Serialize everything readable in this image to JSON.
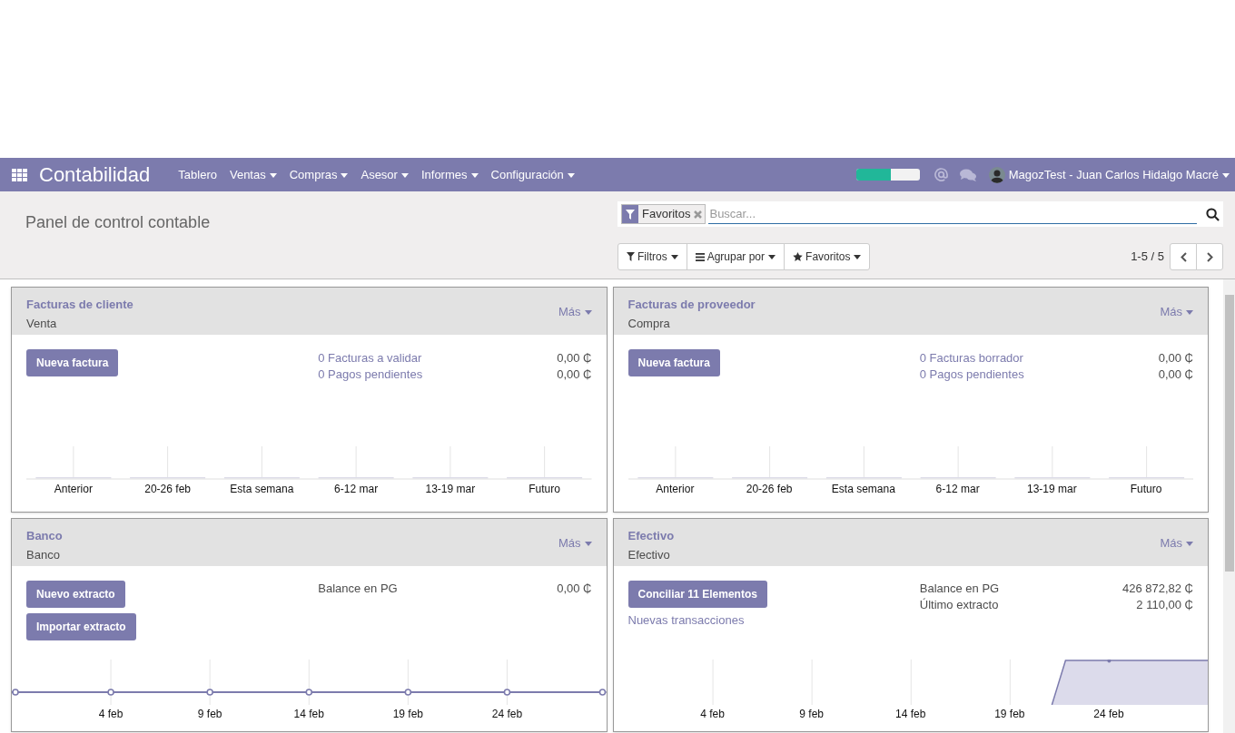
{
  "app": {
    "title": "Contabilidad"
  },
  "menu": [
    {
      "label": "Tablero",
      "dropdown": false
    },
    {
      "label": "Ventas",
      "dropdown": true
    },
    {
      "label": "Compras",
      "dropdown": true
    },
    {
      "label": "Asesor",
      "dropdown": true
    },
    {
      "label": "Informes",
      "dropdown": true
    },
    {
      "label": "Configuración",
      "dropdown": true
    }
  ],
  "systray": {
    "progress": {
      "level": 0.54
    },
    "user": "MagozTest - Juan Carlos Hidalgo Macré"
  },
  "control_panel": {
    "breadcrumb": "Panel de control contable",
    "search": {
      "facets": [
        "Favoritos"
      ],
      "placeholder": "Buscar..."
    },
    "buttons": [
      "Filtros",
      "Agrupar por",
      "Favoritos"
    ],
    "pager": "1-5 / 5"
  },
  "cards": [
    {
      "title": "Facturas de cliente",
      "subtitle": "Venta",
      "more": "Más",
      "buttons": [
        "Nueva factura"
      ],
      "stats": [
        {
          "label": "0 Facturas a validar",
          "value": "0,00 ₵",
          "kind": "link"
        },
        {
          "label": "0 Pagos pendientes",
          "value": "0,00 ₵",
          "kind": "link"
        }
      ],
      "chart": {
        "kind": "bar",
        "labels": [
          "Anterior",
          "20-26 feb",
          "Esta semana",
          "6-12 mar",
          "13-19 mar",
          "Futuro"
        ]
      }
    },
    {
      "title": "Facturas de proveedor",
      "subtitle": "Compra",
      "more": "Más",
      "buttons": [
        "Nueva factura"
      ],
      "stats": [
        {
          "label": "0 Facturas borrador",
          "value": "0,00 ₵",
          "kind": "link"
        },
        {
          "label": "0 Pagos pendientes",
          "value": "0,00 ₵",
          "kind": "link"
        }
      ],
      "chart": {
        "kind": "bar",
        "labels": [
          "Anterior",
          "20-26 feb",
          "Esta semana",
          "6-12 mar",
          "13-19 mar",
          "Futuro"
        ]
      }
    },
    {
      "title": "Banco",
      "subtitle": "Banco",
      "more": "Más",
      "buttons": [
        "Nuevo extracto",
        "Importar extracto"
      ],
      "stats": [
        {
          "label": "Balance en PG",
          "value": "0,00 ₵",
          "kind": "plain"
        }
      ],
      "chart": {
        "kind": "line",
        "labels": [
          "4 feb",
          "9 feb",
          "14 feb",
          "19 feb",
          "24 feb"
        ]
      }
    },
    {
      "title": "Efectivo",
      "subtitle": "Efectivo",
      "more": "Más",
      "buttons": [
        "Conciliar 11 Elementos"
      ],
      "links": [
        "Nuevas transacciones"
      ],
      "stats": [
        {
          "label": "Balance en PG",
          "value": "426 872,82 ₵",
          "kind": "plain"
        },
        {
          "label": "Último extracto",
          "value": "2 110,00 ₵",
          "kind": "plain"
        }
      ],
      "chart": {
        "kind": "area",
        "labels": [
          "4 feb",
          "9 feb",
          "14 feb",
          "19 feb",
          "24 feb"
        ]
      }
    }
  ]
}
